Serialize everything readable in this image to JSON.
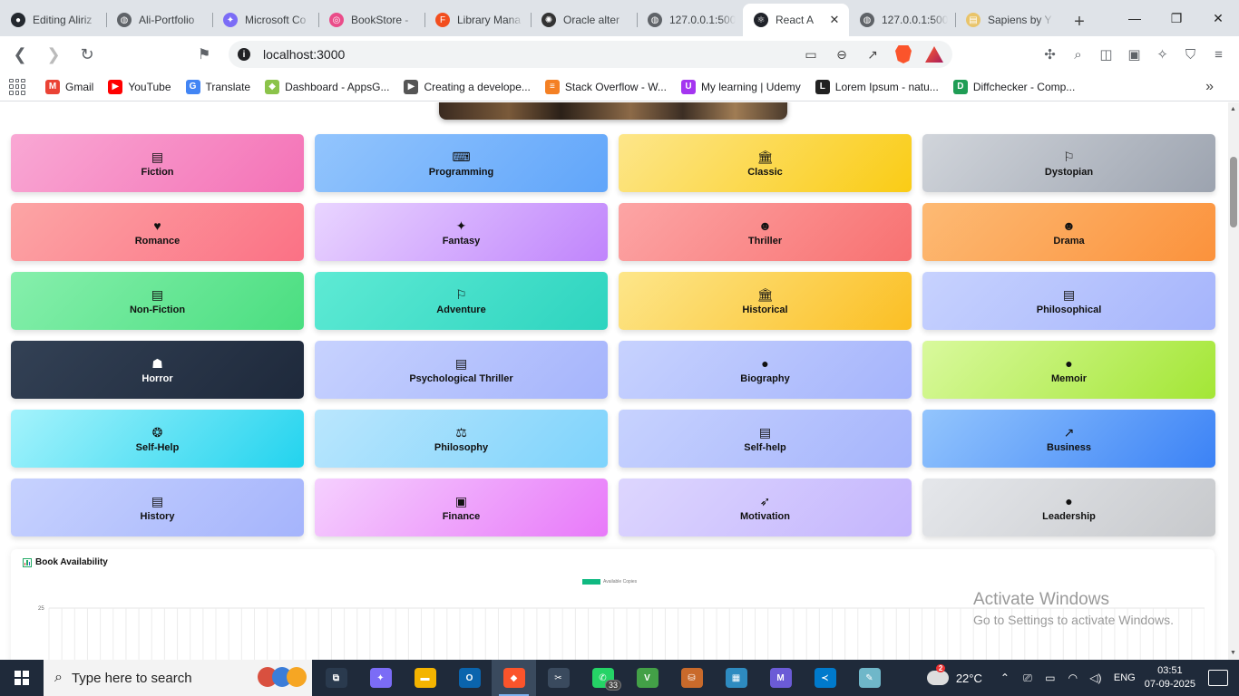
{
  "browser": {
    "tabs": [
      {
        "title": "Editing Aliriz",
        "icon": "github-icon",
        "color": "#24292f",
        "glyph": "●"
      },
      {
        "title": "Ali-Portfolio",
        "icon": "globe-icon",
        "color": "#5f6368",
        "glyph": "◍"
      },
      {
        "title": "Microsoft Co",
        "icon": "copilot-icon",
        "color": "#7b6cf6",
        "glyph": "✦"
      },
      {
        "title": "BookStore -",
        "icon": "dribbble-icon",
        "color": "#ea4c89",
        "glyph": "◎"
      },
      {
        "title": "Library Mana",
        "icon": "figma-icon",
        "color": "#f24e1e",
        "glyph": "F"
      },
      {
        "title": "Oracle alter",
        "icon": "chatgpt-icon",
        "color": "#333333",
        "glyph": "✺"
      },
      {
        "title": "127.0.0.1:500",
        "icon": "globe-icon",
        "color": "#5f6368",
        "glyph": "◍"
      },
      {
        "title": "React A",
        "icon": "react-icon",
        "color": "#20232a",
        "glyph": "⚛",
        "active": true
      },
      {
        "title": "127.0.0.1:500",
        "icon": "globe-icon",
        "color": "#5f6368",
        "glyph": "◍"
      },
      {
        "title": "Sapiens by Y",
        "icon": "book-cover-icon",
        "color": "#e9c46a",
        "glyph": "▤"
      }
    ],
    "close_glyph": "✕",
    "newtab_glyph": "+",
    "window_controls": {
      "minimize": "—",
      "maximize": "❐",
      "close": "✕"
    },
    "url": "localhost:3000",
    "brave_badge": "1",
    "bookmarks": [
      {
        "label": "Gmail",
        "icon": "gmail-icon",
        "color": "#ea4335",
        "glyph": "M"
      },
      {
        "label": "YouTube",
        "icon": "youtube-icon",
        "color": "#ff0000",
        "glyph": "▶"
      },
      {
        "label": "Translate",
        "icon": "translate-icon",
        "color": "#4285f4",
        "glyph": "G"
      },
      {
        "label": "Dashboard - AppsG...",
        "icon": "appsgeyser-icon",
        "color": "#8bc34a",
        "glyph": "◆"
      },
      {
        "label": "Creating a develope...",
        "icon": "dev-icon",
        "color": "#555555",
        "glyph": "▶"
      },
      {
        "label": "Stack Overflow - W...",
        "icon": "stackoverflow-icon",
        "color": "#f48024",
        "glyph": "≡"
      },
      {
        "label": "My learning | Udemy",
        "icon": "udemy-icon",
        "color": "#a435f0",
        "glyph": "U"
      },
      {
        "label": "Lorem Ipsum - natu...",
        "icon": "lorem-icon",
        "color": "#222222",
        "glyph": "L"
      },
      {
        "label": "Diffchecker - Comp...",
        "icon": "diffchecker-icon",
        "color": "#1f9d55",
        "glyph": "D"
      }
    ],
    "bookmarks_more": "»"
  },
  "genres": [
    {
      "label": "Fiction",
      "icon": "book-icon",
      "glyph": "▤",
      "from": "#f9a8d4",
      "to": "#f472b6"
    },
    {
      "label": "Programming",
      "icon": "laptop-code-icon",
      "glyph": "⌨",
      "from": "#93c5fd",
      "to": "#60a5fa"
    },
    {
      "label": "Classic",
      "icon": "landmark-icon",
      "glyph": "🏛",
      "from": "#fde68a",
      "to": "#facc15"
    },
    {
      "label": "Dystopian",
      "icon": "map-location-icon",
      "glyph": "⚐",
      "from": "#d1d5db",
      "to": "#9ca3af"
    },
    {
      "label": "Romance",
      "icon": "heart-icon",
      "glyph": "♥",
      "from": "#fca5a5",
      "to": "#fb7185"
    },
    {
      "label": "Fantasy",
      "icon": "magic-wand-icon",
      "glyph": "✦",
      "from": "#e9d5ff",
      "to": "#c084fc"
    },
    {
      "label": "Thriller",
      "icon": "theater-masks-icon",
      "glyph": "☻",
      "from": "#fca5a5",
      "to": "#f87171"
    },
    {
      "label": "Drama",
      "icon": "theater-masks-icon",
      "glyph": "☻",
      "from": "#fdba74",
      "to": "#fb923c"
    },
    {
      "label": "Non-Fiction",
      "icon": "book-icon",
      "glyph": "▤",
      "from": "#86efac",
      "to": "#4ade80"
    },
    {
      "label": "Adventure",
      "icon": "map-location-icon",
      "glyph": "⚐",
      "from": "#5eead4",
      "to": "#2dd4bf"
    },
    {
      "label": "Historical",
      "icon": "landmark-icon",
      "glyph": "🏛",
      "from": "#fde68a",
      "to": "#fbbf24"
    },
    {
      "label": "Philosophical",
      "icon": "book-icon",
      "glyph": "▤",
      "from": "#c7d2fe",
      "to": "#a5b4fc"
    },
    {
      "label": "Horror",
      "icon": "ghost-icon",
      "glyph": "☗",
      "from": "#334155",
      "to": "#1e293b",
      "dark": true
    },
    {
      "label": "Psychological Thriller",
      "icon": "book-icon",
      "glyph": "▤",
      "from": "#c7d2fe",
      "to": "#a5b4fc"
    },
    {
      "label": "Biography",
      "icon": "user-icon",
      "glyph": "●",
      "from": "#c7d2fe",
      "to": "#a5b4fc"
    },
    {
      "label": "Memoir",
      "icon": "user-tie-icon",
      "glyph": "●",
      "from": "#d9f99d",
      "to": "#a3e635"
    },
    {
      "label": "Self-Help",
      "icon": "brain-icon",
      "glyph": "❂",
      "from": "#a5f3fc",
      "to": "#22d3ee"
    },
    {
      "label": "Philosophy",
      "icon": "scale-balance-icon",
      "glyph": "⚖",
      "from": "#bae6fd",
      "to": "#7dd3fc"
    },
    {
      "label": "Self-help",
      "icon": "book-icon",
      "glyph": "▤",
      "from": "#c7d2fe",
      "to": "#a5b4fc"
    },
    {
      "label": "Business",
      "icon": "chart-line-icon",
      "glyph": "↗",
      "from": "#93c5fd",
      "to": "#3b82f6"
    },
    {
      "label": "History",
      "icon": "book-icon",
      "glyph": "▤",
      "from": "#c7d2fe",
      "to": "#a5b4fc"
    },
    {
      "label": "Finance",
      "icon": "money-bill-icon",
      "glyph": "▣",
      "from": "#f5d0fe",
      "to": "#e879f9"
    },
    {
      "label": "Motivation",
      "icon": "rocket-icon",
      "glyph": "➶",
      "from": "#ddd6fe",
      "to": "#c4b5fd"
    },
    {
      "label": "Leadership",
      "icon": "user-tie-icon",
      "glyph": "●",
      "from": "#e5e7eb",
      "to": "#c7c9cc"
    }
  ],
  "chart_data": {
    "type": "bar",
    "title": "Book Availability",
    "series": [
      {
        "name": "Available Copies",
        "color": "#10b981"
      }
    ],
    "ylim_top_tick": "25",
    "grid": true,
    "legend": "top-center"
  },
  "watermark": {
    "line1": "Activate Windows",
    "line2": "Go to Settings to activate Windows."
  },
  "taskbar": {
    "search_placeholder": "Type here to search",
    "apps": [
      {
        "name": "task-view",
        "icon": "task-view-icon",
        "color": "#2a3a4e",
        "glyph": "⧉"
      },
      {
        "name": "copilot",
        "icon": "copilot-icon",
        "color": "#7b6cf6",
        "glyph": "✦"
      },
      {
        "name": "file-explorer",
        "icon": "folder-icon",
        "color": "#f4b400",
        "glyph": "▬"
      },
      {
        "name": "outlook",
        "icon": "outlook-icon",
        "color": "#0a64ad",
        "glyph": "O"
      },
      {
        "name": "brave",
        "icon": "brave-icon",
        "color": "#fb542b",
        "glyph": "◆",
        "active": true
      },
      {
        "name": "snipping-tool",
        "icon": "snipping-tool-icon",
        "color": "#3a4a5e",
        "glyph": "✂"
      },
      {
        "name": "whatsapp",
        "icon": "whatsapp-icon",
        "color": "#25d366",
        "glyph": "✆",
        "badge": "33"
      },
      {
        "name": "vim",
        "icon": "vim-icon",
        "color": "#43a047",
        "glyph": "V"
      },
      {
        "name": "sql-developer",
        "icon": "database-icon",
        "color": "#c96a2b",
        "glyph": "⛁"
      },
      {
        "name": "control-panel",
        "icon": "control-panel-icon",
        "color": "#2e8bc0",
        "glyph": "▦"
      },
      {
        "name": "m365",
        "icon": "microsoft-365-icon",
        "color": "#6b5bd6",
        "glyph": "M"
      },
      {
        "name": "vscode",
        "icon": "vscode-icon",
        "color": "#007acc",
        "glyph": "≺"
      },
      {
        "name": "notepad",
        "icon": "notepad-icon",
        "color": "#6fb7c9",
        "glyph": "✎"
      }
    ],
    "weather": {
      "temp": "22°C",
      "badge": "2"
    },
    "language": "ENG",
    "time": "03:51",
    "date": "07-09-2025"
  }
}
